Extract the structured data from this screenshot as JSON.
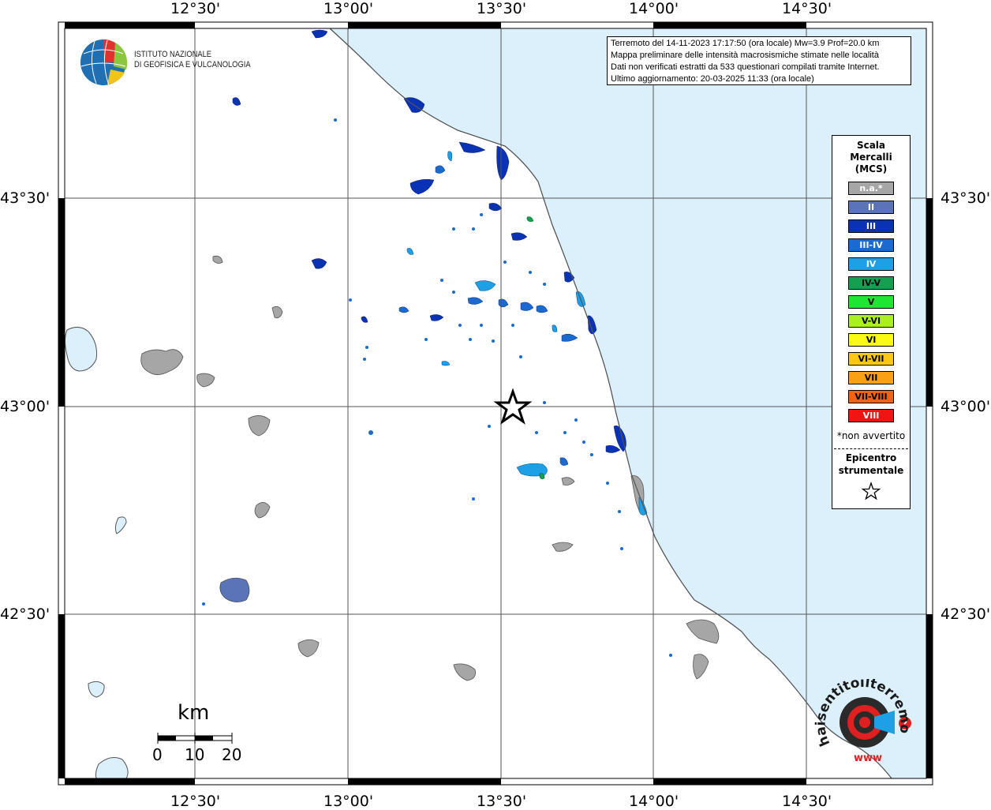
{
  "info": {
    "line1": "Terremoto del 14-11-2023 17:17:50 (ora locale) Mw=3.9 Prof=20.0 km",
    "line2": "Mappa preliminare delle intensità macrosismiche stimate nelle località",
    "line3": "Dati non verificati estratti da 533 questionari compilati tramite Internet.",
    "line4": "Ultimo aggiornamento: 20-03-2025 11:33 (ora locale)"
  },
  "logo": {
    "line1": "ISTITUTO NAZIONALE",
    "line2": "DI GEOFISICA E VULCANOLOGIA"
  },
  "coords": {
    "lon": [
      "12°30'",
      "13°00'",
      "13°30'",
      "14°00'",
      "14°30'"
    ],
    "lat": [
      "43°30'",
      "43°00'",
      "42°30'"
    ]
  },
  "legend": {
    "title1": "Scala",
    "title2": "Mercalli",
    "title3": "(MCS)",
    "items": [
      {
        "label": "n.a.*",
        "color": "#a6a6a6",
        "text_color": "#ffffff"
      },
      {
        "label": "II",
        "color": "#5b73b7",
        "text_color": "#ffffff"
      },
      {
        "label": "III",
        "color": "#0a32b4",
        "text_color": "#ffffff"
      },
      {
        "label": "III-IV",
        "color": "#1a6ad2",
        "text_color": "#ffffff"
      },
      {
        "label": "IV",
        "color": "#1ea0e6",
        "text_color": "#ffffff"
      },
      {
        "label": "IV-V",
        "color": "#14a050",
        "text_color": "#000000"
      },
      {
        "label": "V",
        "color": "#1ee632",
        "text_color": "#000000"
      },
      {
        "label": "V-VI",
        "color": "#aaf01e",
        "text_color": "#000000"
      },
      {
        "label": "VI",
        "color": "#fafa14",
        "text_color": "#000000"
      },
      {
        "label": "VI-VII",
        "color": "#fac814",
        "text_color": "#000000"
      },
      {
        "label": "VII",
        "color": "#faa014",
        "text_color": "#000000"
      },
      {
        "label": "VII-VIII",
        "color": "#f06414",
        "text_color": "#000000"
      },
      {
        "label": "VIII",
        "color": "#f01414",
        "text_color": "#ffffff"
      }
    ],
    "note": "*non avvertito",
    "epi1": "Epicentro",
    "epi2": "strumentale"
  },
  "scale": {
    "unit": "km",
    "labels": [
      "0",
      "10",
      "20"
    ]
  },
  "badge": {
    "text": "haisentitoilterremoto.it",
    "www": "www"
  },
  "colors": {
    "sea": "#dcf0fc",
    "lake": "#dcf0fc",
    "grid": "#555555"
  }
}
